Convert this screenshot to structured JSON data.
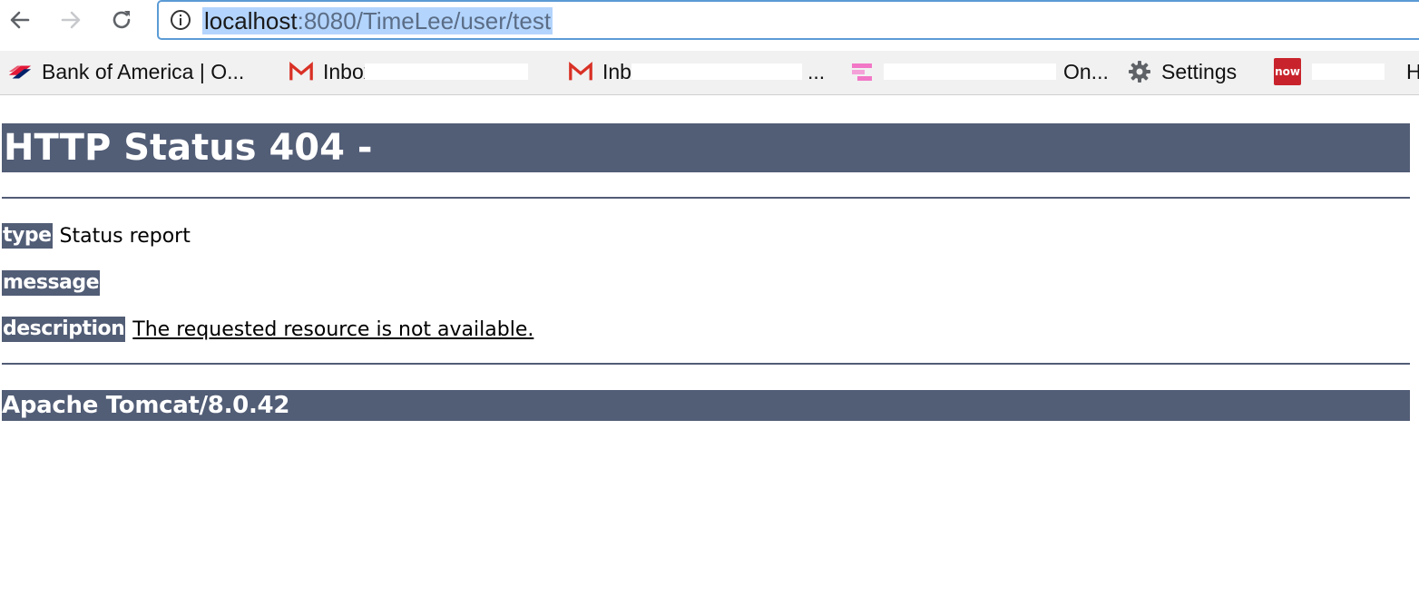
{
  "browser": {
    "url_host": "localhost",
    "url_rest": ":8080/TimeLee/user/test",
    "bookmarks": [
      {
        "label": "Bank of America | O...",
        "icon": "bank-of-america-icon"
      },
      {
        "label": "Inbox",
        "icon": "gmail-icon"
      },
      {
        "label": "Inb",
        "icon": "gmail-icon"
      },
      {
        "label": "On...",
        "icon": "pink-app-icon"
      },
      {
        "label": "Settings",
        "icon": "gear-icon"
      },
      {
        "label": "Hor",
        "icon": "servicenow-icon",
        "icon_text": "now"
      }
    ]
  },
  "page": {
    "title": "HTTP Status 404 -",
    "type_label": "type",
    "type_value": "Status report",
    "message_label": "message",
    "message_value": "",
    "description_label": "description",
    "description_value": "The requested resource is not available.",
    "footer": "Apache Tomcat/8.0.42"
  },
  "colors": {
    "tomcat_header": "#525d76",
    "url_highlight": "#b3d4fd",
    "omnibox_border": "#5b9bd5"
  }
}
